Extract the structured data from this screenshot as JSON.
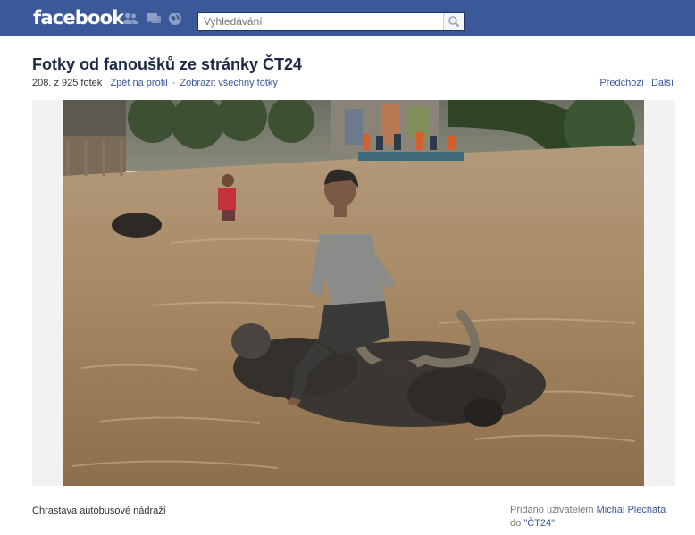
{
  "topbar": {
    "logo_text": "facebook",
    "search": {
      "placeholder": "Vyhledávání",
      "icon": "search-icon"
    },
    "jewels": [
      "friend-requests-icon",
      "messages-icon",
      "notifications-icon"
    ],
    "bar_color": "#3b5998"
  },
  "album": {
    "title": "Fotky od fanoušků ze stránky ČT24",
    "photo_index": "208. z 925 fotek",
    "back_link": "Zpět na profil",
    "separator": "·",
    "all_photos_link": "Zobrazit všechny fotky",
    "prev_label": "Předchozí",
    "next_label": "Další"
  },
  "photo": {
    "description": "Flooded street; a man rides a water buffalo through brown floodwater"
  },
  "caption": {
    "text": "Chrastava autobusové nádraží",
    "added_prefix": "Přidáno uživatelem",
    "author": "Michal Plechata",
    "to_prefix": "do",
    "page_name": "\"ČT24\""
  },
  "colors": {
    "link": "#3b5998",
    "title": "#1c2a47"
  }
}
